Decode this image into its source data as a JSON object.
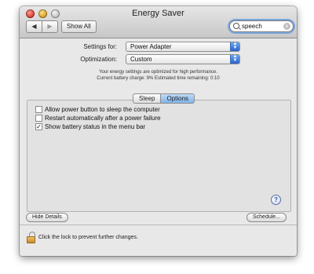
{
  "window": {
    "title": "Energy Saver"
  },
  "toolbar": {
    "back_label": "◀",
    "forward_label": "▶",
    "show_all_label": "Show All",
    "search_value": "speech"
  },
  "settings": {
    "settings_for_label": "Settings for:",
    "settings_for_value": "Power Adapter",
    "optimization_label": "Optimization:",
    "optimization_value": "Custom",
    "info_line1": "Your energy settings are optimized for high performance.",
    "info_line2": "Current battery charge: 9%  Estimated time remaining: 0:10"
  },
  "tabs": [
    {
      "label": "Sleep",
      "selected": false
    },
    {
      "label": "Options",
      "selected": true
    }
  ],
  "options": [
    {
      "label": "Allow power button to sleep the computer",
      "checked": false
    },
    {
      "label": "Restart automatically after a power failure",
      "checked": false
    },
    {
      "label": "Show battery status in the menu bar",
      "checked": true
    }
  ],
  "buttons": {
    "hide_details_label": "Hide Details",
    "schedule_label": "Schedule..."
  },
  "footer": {
    "lock_message": "Click the lock to prevent further changes."
  }
}
